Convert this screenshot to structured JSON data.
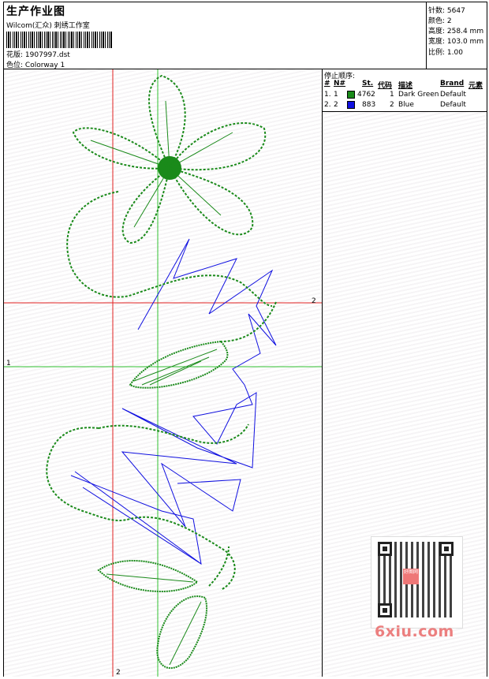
{
  "header": {
    "title": "生产作业图",
    "subtitle": "Wilcom(汇众) 刺绣工作室",
    "design_label": "花版:",
    "design_file": "1907997.dst",
    "colorway_label": "色位:",
    "colorway": "Colorway 1"
  },
  "stats": [
    {
      "label": "针数:",
      "value": "5647"
    },
    {
      "label": "颜色:",
      "value": "2"
    },
    {
      "label": "高度:",
      "value": "258.4 mm"
    },
    {
      "label": "宽度:",
      "value": "103.0 mm"
    },
    {
      "label": "比例:",
      "value": "1.00"
    }
  ],
  "stop_sequence": {
    "title": "停止顺序:",
    "headers": {
      "num": "#",
      "n": "N#",
      "st": "St.",
      "code": "代码",
      "desc": "描述",
      "brand": "Brand",
      "elem": "元素"
    },
    "rows": [
      {
        "num": "1.",
        "n": "1",
        "color": "#1a8a1a",
        "st": "4762",
        "code": "1",
        "desc": "Dark Green",
        "brand": "Default"
      },
      {
        "num": "2.",
        "n": "2",
        "color": "#1010e0",
        "st": "883",
        "code": "2",
        "desc": "Blue",
        "brand": "Default"
      }
    ]
  },
  "axes": {
    "h_red_label": "2",
    "h_green_label": "1",
    "v_red_label": "2"
  },
  "colors": {
    "green": "#1a8a1a",
    "blue": "#1010e0",
    "red_line": "#e02020",
    "green_line": "#30c030"
  },
  "watermark": {
    "text": "6xiu.com",
    "stamp": "好图网"
  }
}
